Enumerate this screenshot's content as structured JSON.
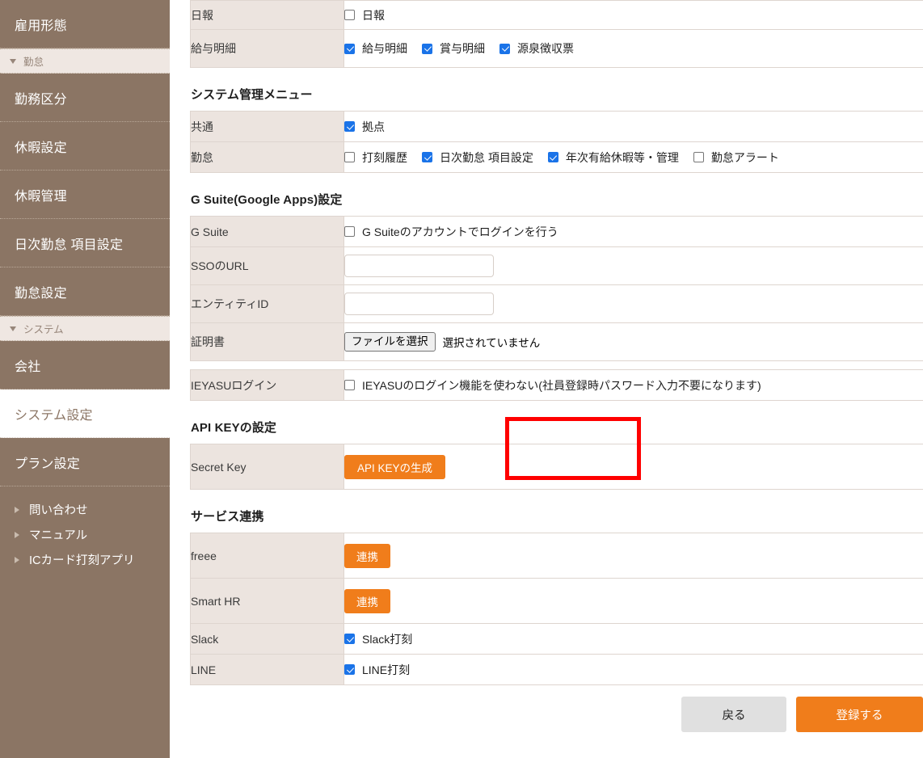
{
  "colors": {
    "sidebar_bg": "#8b7564",
    "sidebar_group_bg": "#efe7e2",
    "label_cell_bg": "#ece4df",
    "accent_orange": "#f07d1b",
    "checkbox_blue": "#1a73e8",
    "annotation_red": "#ff0000",
    "back_button_gray": "#e0e0e0"
  },
  "sidebar": {
    "top_item": {
      "label": "雇用形態",
      "active": false
    },
    "groups": [
      {
        "header": "勤怠",
        "caret_icon": "triangle-down-icon",
        "items": [
          {
            "label": "勤務区分",
            "active": false
          },
          {
            "label": "休暇設定",
            "active": false
          },
          {
            "label": "休暇管理",
            "active": false
          },
          {
            "label": "日次勤怠 項目設定",
            "active": false
          },
          {
            "label": "勤怠設定",
            "active": false
          }
        ]
      },
      {
        "header": "システム",
        "caret_icon": "triangle-down-icon",
        "items": [
          {
            "label": "会社",
            "active": false
          },
          {
            "label": "システム設定",
            "active": true
          },
          {
            "label": "プラン設定",
            "active": false
          }
        ]
      }
    ],
    "sub_links": [
      {
        "label": "問い合わせ",
        "caret_icon": "triangle-right-icon"
      },
      {
        "label": "マニュアル",
        "caret_icon": "triangle-right-icon"
      },
      {
        "label": "ICカード打刻アプリ",
        "caret_icon": "triangle-right-icon"
      }
    ]
  },
  "main": {
    "top_table": {
      "rows": [
        {
          "label": "日報",
          "checkboxes": [
            {
              "label": "日報",
              "checked": false
            }
          ]
        },
        {
          "label": "給与明細",
          "checkboxes": [
            {
              "label": "給与明細",
              "checked": true
            },
            {
              "label": "賞与明細",
              "checked": true
            },
            {
              "label": "源泉徴収票",
              "checked": true
            }
          ]
        }
      ]
    },
    "sections": [
      {
        "title": "システム管理メニュー",
        "rows": [
          {
            "label": "共通",
            "checkboxes": [
              {
                "label": "拠点",
                "checked": true
              }
            ]
          },
          {
            "label": "勤怠",
            "checkboxes": [
              {
                "label": "打刻履歴",
                "checked": false
              },
              {
                "label": "日次勤怠 項目設定",
                "checked": true
              },
              {
                "label": "年次有給休暇等・管理",
                "checked": true
              },
              {
                "label": "勤怠アラート",
                "checked": false
              }
            ]
          }
        ]
      },
      {
        "title": "G Suite(Google Apps)設定",
        "rows": [
          {
            "label": "G Suite",
            "checkboxes": [
              {
                "label": "G Suiteのアカウントでログインを行う",
                "checked": false
              }
            ]
          },
          {
            "label": "SSOのURL",
            "input": {
              "value": "",
              "placeholder": ""
            }
          },
          {
            "label": "エンティティID",
            "input": {
              "value": "",
              "placeholder": ""
            }
          },
          {
            "label": "証明書",
            "file": {
              "button_label": "ファイルを選択",
              "status": "選択されていません"
            }
          }
        ]
      }
    ],
    "ieyasu_row": {
      "label": "IEYASUログイン",
      "checkboxes": [
        {
          "label": "IEYASUのログイン機能を使わない(社員登録時パスワード入力不要になります)",
          "checked": false
        }
      ]
    },
    "api_section": {
      "title": "API KEYの設定",
      "row": {
        "label": "Secret Key",
        "button_label": "API KEYの生成"
      },
      "annotation": "red-highlight-box"
    },
    "service_section": {
      "title": "サービス連携",
      "rows": [
        {
          "label": "freee",
          "button_label": "連携"
        },
        {
          "label": "Smart HR",
          "button_label": "連携"
        },
        {
          "label": "Slack",
          "checkboxes": [
            {
              "label": "Slack打刻",
              "checked": true
            }
          ]
        },
        {
          "label": "LINE",
          "checkboxes": [
            {
              "label": "LINE打刻",
              "checked": true
            }
          ]
        }
      ]
    },
    "footer": {
      "back_label": "戻る",
      "submit_label": "登録する"
    }
  }
}
